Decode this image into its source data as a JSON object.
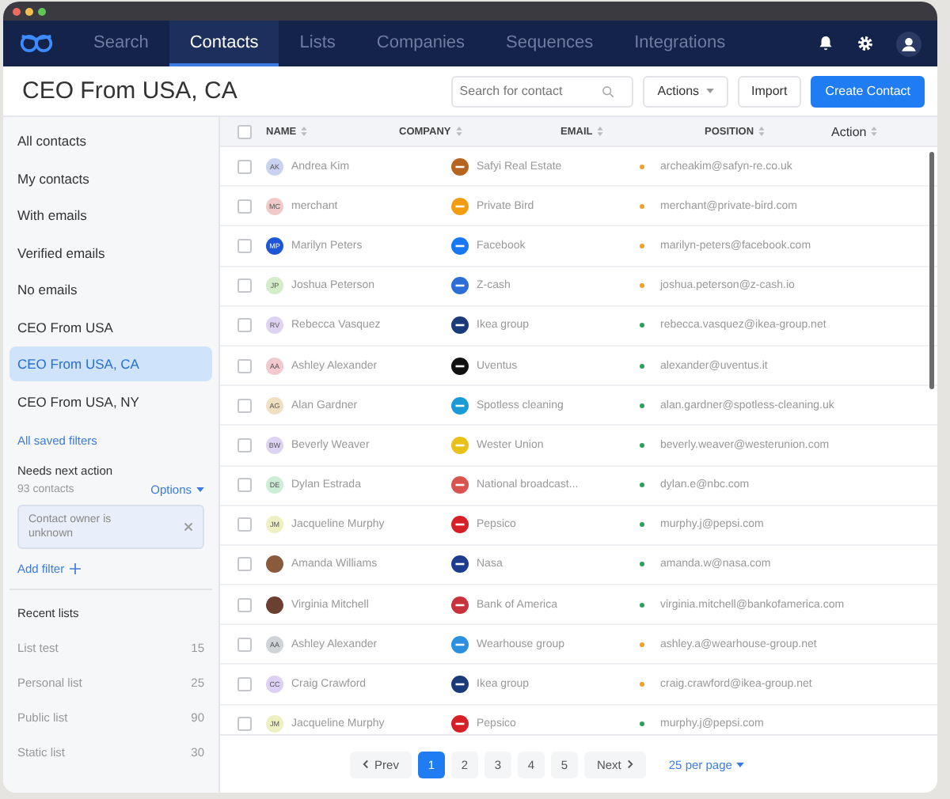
{
  "nav": {
    "tabs": [
      {
        "label": "Search",
        "selected": false
      },
      {
        "label": "Contacts",
        "selected": true
      },
      {
        "label": "Lists",
        "selected": false
      },
      {
        "label": "Companies",
        "selected": false
      },
      {
        "label": "Sequences",
        "selected": false
      },
      {
        "label": "Integrations",
        "selected": false
      }
    ]
  },
  "header": {
    "title": "CEO From USA, CA",
    "search": {
      "placeholder": "Search for contact"
    },
    "actions": "Actions",
    "import": "Import",
    "create": "Create Contact"
  },
  "sidebar": {
    "filters": [
      {
        "label": "All contacts",
        "selected": false
      },
      {
        "label": "My contacts",
        "selected": false
      },
      {
        "label": "With emails",
        "selected": false
      },
      {
        "label": "Verified emails",
        "selected": false
      },
      {
        "label": "No emails",
        "selected": false
      },
      {
        "label": "CEO From USA",
        "selected": false
      },
      {
        "label": "CEO From USA, CA",
        "selected": true
      },
      {
        "label": "CEO From USA, NY",
        "selected": false
      }
    ],
    "all_saved": "All saved filters",
    "section": "Needs next action",
    "count": "93 contacts",
    "options": "Options",
    "chip": "Contact owner is unknown",
    "add_filter": "Add filter",
    "recent_title": "Recent lists",
    "recent": [
      {
        "name": "List test",
        "count": "15"
      },
      {
        "name": "Personal list",
        "count": "25"
      },
      {
        "name": "Public list",
        "count": "90"
      },
      {
        "name": "Static list",
        "count": "30"
      }
    ]
  },
  "table": {
    "select_all_checked": false,
    "columns": [
      "NAME",
      "COMPANY",
      "EMAIL",
      "POSITION",
      "Action"
    ],
    "rows": [
      {
        "checked": false,
        "avatar": {
          "kind": "initials",
          "initials": "AK",
          "color": "#c9d3f0",
          "dark": false
        },
        "name": "Andrea Kim",
        "company": "Safyi Real Estate",
        "logo": {
          "color": "#b5651d"
        },
        "email": "archeakim@safyn-re.co.uk",
        "color": "#f0a030"
      },
      {
        "checked": false,
        "avatar": {
          "kind": "initials",
          "initials": "MC",
          "color": "#f2c9c9",
          "dark": false
        },
        "name": "merchant",
        "company": "Private Bird",
        "logo": {
          "color": "#f39c12"
        },
        "email": "merchant@private-bird.com",
        "color": "#f0a030"
      },
      {
        "checked": false,
        "avatar": {
          "kind": "initials",
          "initials": "MP",
          "color": "#1e56d8",
          "dark": true
        },
        "name": "Marilyn Peters",
        "company": "Facebook",
        "logo": {
          "color": "#1877f2"
        },
        "email": "marilyn-peters@facebook.com",
        "color": "#f0a030"
      },
      {
        "checked": false,
        "avatar": {
          "kind": "initials",
          "initials": "JP",
          "color": "#d3ecc9",
          "dark": false
        },
        "name": "Joshua Peterson",
        "company": "Z-cash",
        "logo": {
          "color": "#2b6fd6"
        },
        "email": "joshua.peterson@z-cash.io",
        "color": "#f0a030"
      },
      {
        "checked": false,
        "avatar": {
          "kind": "initials",
          "initials": "RV",
          "color": "#e0d3f2",
          "dark": false
        },
        "name": "Rebecca Vasquez",
        "company": "Ikea group",
        "logo": {
          "color": "#1b3a7a"
        },
        "email": "rebecca.vasquez@ikea-group.net",
        "color": "#2e9e5b"
      },
      {
        "checked": false,
        "avatar": {
          "kind": "initials",
          "initials": "AA",
          "color": "#f2c9cf",
          "dark": false
        },
        "name": "Ashley Alexander",
        "company": "Uventus",
        "logo": {
          "color": "#111111"
        },
        "email": "alexander@uventus.it",
        "color": "#2e9e5b"
      },
      {
        "checked": false,
        "avatar": {
          "kind": "initials",
          "initials": "AG",
          "color": "#efe0c2",
          "dark": false
        },
        "name": "Alan Gardner",
        "company": "Spotless cleaning",
        "logo": {
          "color": "#1a9ad6"
        },
        "email": "alan.gardner@spotless-cleaning.uk",
        "color": "#2e9e5b"
      },
      {
        "checked": false,
        "avatar": {
          "kind": "initials",
          "initials": "BW",
          "color": "#ddd3f2",
          "dark": false
        },
        "name": "Beverly Weaver",
        "company": "Wester Union",
        "logo": {
          "color": "#e8c21a"
        },
        "email": "beverly.weaver@westerunion.com",
        "color": "#2e9e5b"
      },
      {
        "checked": false,
        "avatar": {
          "kind": "initials",
          "initials": "DE",
          "color": "#cdeed6",
          "dark": false
        },
        "name": "Dylan Estrada",
        "company": "National broadcast...",
        "logo": {
          "color": "#d9534f"
        },
        "email": "dylan.e@nbc.com",
        "color": "#2e9e5b"
      },
      {
        "checked": false,
        "avatar": {
          "kind": "initials",
          "initials": "JM",
          "color": "#eef0c2",
          "dark": false
        },
        "name": "Jacqueline Murphy",
        "company": "Pepsico",
        "logo": {
          "color": "#d62027"
        },
        "email": "murphy.j@pepsi.com",
        "color": "#2e9e5b"
      },
      {
        "checked": false,
        "avatar": {
          "kind": "photo",
          "color": "#8a5a3c"
        },
        "name": "Amanda Williams",
        "company": "Nasa",
        "logo": {
          "color": "#1d3c8f"
        },
        "email": "amanda.w@nasa.com",
        "color": "#2e9e5b"
      },
      {
        "checked": false,
        "avatar": {
          "kind": "photo",
          "color": "#6b4030"
        },
        "name": "Virginia Mitchell",
        "company": "Bank of America",
        "logo": {
          "color": "#c8323c"
        },
        "email": "virginia.mitchell@bankofamerica.com",
        "color": "#2e9e5b"
      },
      {
        "checked": false,
        "avatar": {
          "kind": "initials",
          "initials": "AA",
          "color": "#d0d3d8",
          "dark": false
        },
        "name": "Ashley Alexander",
        "company": "Wearhouse group",
        "logo": {
          "color": "#2c8fe0"
        },
        "email": "ashley.a@wearhouse-group.net",
        "color": "#f0a030"
      },
      {
        "checked": false,
        "avatar": {
          "kind": "initials",
          "initials": "CC",
          "color": "#ddd0f2",
          "dark": false
        },
        "name": "Craig Crawford",
        "company": "Ikea group",
        "logo": {
          "color": "#1b3a7a"
        },
        "email": "craig.crawford@ikea-group.net",
        "color": "#f0a030"
      },
      {
        "checked": false,
        "avatar": {
          "kind": "initials",
          "initials": "JM",
          "color": "#eef0c2",
          "dark": false
        },
        "name": "Jacqueline Murphy",
        "company": "Pepsico",
        "logo": {
          "color": "#d62027"
        },
        "email": "murphy.j@pepsi.com",
        "color": "#2e9e5b"
      }
    ]
  },
  "pagination": {
    "prev": "Prev",
    "next": "Next",
    "pages": [
      {
        "label": "1",
        "selected": true
      },
      {
        "label": "2",
        "selected": false
      },
      {
        "label": "3",
        "selected": false
      },
      {
        "label": "4",
        "selected": false
      },
      {
        "label": "5",
        "selected": false
      }
    ],
    "per_page": "25 per page"
  }
}
